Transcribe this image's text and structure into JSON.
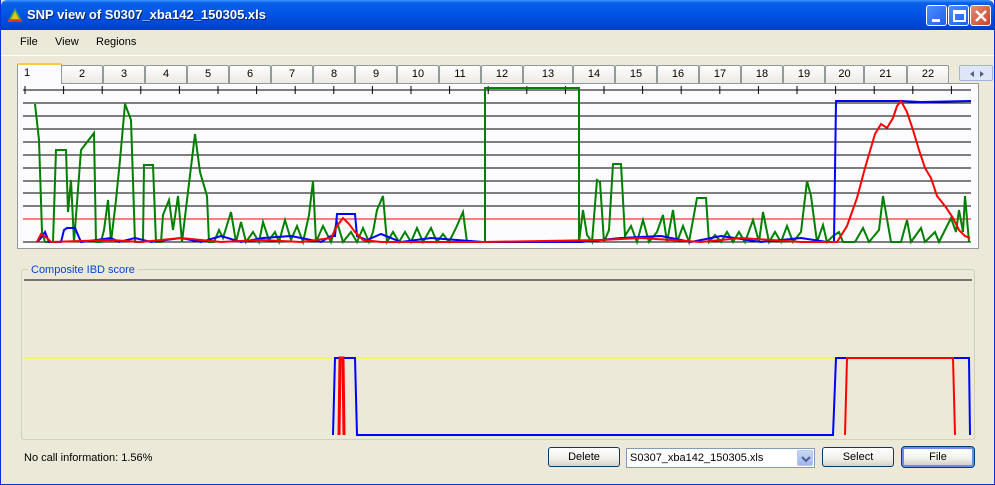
{
  "window": {
    "title": "SNP view of S0307_xba142_150305.xls"
  },
  "menu": {
    "items": [
      "File",
      "View",
      "Regions"
    ]
  },
  "tabs": [
    "1",
    "2",
    "3",
    "4",
    "5",
    "6",
    "7",
    "8",
    "9",
    "10",
    "11",
    "12",
    "13",
    "14",
    "15",
    "16",
    "17",
    "18",
    "19",
    "20",
    "21",
    "22"
  ],
  "active_tab": "1",
  "group": {
    "label": "Composite IBD score"
  },
  "status": {
    "text": "No call information: 1.56%"
  },
  "buttons": {
    "delete": "Delete",
    "select": "Select",
    "file": "File"
  },
  "dropdown": {
    "value": "S0307_xba142_150305.xls"
  },
  "colors": {
    "green": "#008000",
    "blue": "#0000ff",
    "red": "#ff0000",
    "yellow": "#ffff00",
    "accent": "#0046d5"
  },
  "icons": {
    "app": "snp-view-app-icon",
    "minimize": "minimize-icon",
    "maximize": "maximize-icon",
    "close": "close-icon"
  }
}
